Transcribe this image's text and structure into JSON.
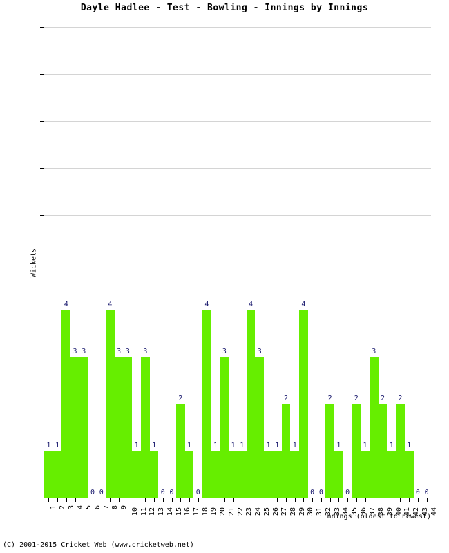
{
  "chart_data": {
    "type": "bar",
    "title": "Dayle Hadlee - Test - Bowling - Innings by Innings",
    "xlabel": "Innings (oldest to newest)",
    "ylabel": "Wickets",
    "categories": [
      "1",
      "2",
      "3",
      "4",
      "5",
      "6",
      "7",
      "8",
      "9",
      "10",
      "11",
      "12",
      "13",
      "14",
      "15",
      "16",
      "17",
      "18",
      "19",
      "20",
      "21",
      "22",
      "23",
      "24",
      "25",
      "26",
      "27",
      "28",
      "29",
      "30",
      "31",
      "32",
      "33",
      "34",
      "35",
      "36",
      "37",
      "38",
      "39",
      "40",
      "41",
      "42",
      "43",
      "44"
    ],
    "values": [
      1,
      1,
      4,
      3,
      3,
      0,
      0,
      4,
      3,
      3,
      1,
      3,
      1,
      0,
      0,
      2,
      1,
      0,
      4,
      1,
      3,
      1,
      1,
      4,
      3,
      1,
      1,
      2,
      1,
      4,
      0,
      0,
      2,
      1,
      0,
      2,
      1,
      3,
      2,
      1,
      2,
      1,
      0,
      0
    ],
    "ylim": [
      0,
      10
    ],
    "yticks": [
      0,
      1,
      2,
      3,
      4,
      5,
      6,
      7,
      8,
      9,
      10
    ],
    "grid": true,
    "legend": null,
    "bar_color": "#66ee00",
    "value_label_color": "#1a1a6e",
    "gridline_color": "#d4d4d4"
  },
  "footer": {
    "copyright": "(C) 2001-2015 Cricket Web (www.cricketweb.net)"
  }
}
